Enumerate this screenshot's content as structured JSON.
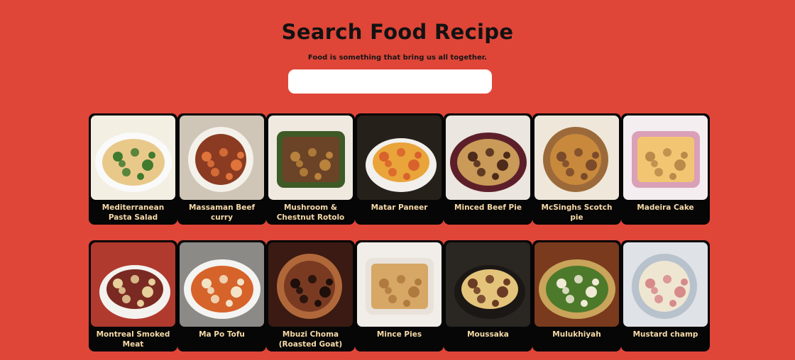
{
  "header": {
    "title": "Search Food Recipe",
    "subtitle": "Food is something that bring us all together."
  },
  "search": {
    "value": "",
    "placeholder": ""
  },
  "colors": {
    "background": "#df4638",
    "card": "#060606",
    "card_text": "#f6d9a8",
    "search_bg": "#ffffff"
  },
  "recipes": [
    {
      "name": "Mediterranean Pasta Salad",
      "image": "pasta-salad-photo",
      "palette": [
        "#f3efe3",
        "#e9c98a",
        "#3f7a2e",
        "#c9352b"
      ]
    },
    {
      "name": "Massaman Beef curry",
      "image": "beef-curry-photo",
      "palette": [
        "#cfc6b8",
        "#8a3b22",
        "#e0743a",
        "#f4f1ea"
      ]
    },
    {
      "name": "Mushroom & Chestnut Rotolo",
      "image": "rotolo-photo",
      "palette": [
        "#efe9e0",
        "#6b4326",
        "#b9823d",
        "#3e5a26"
      ]
    },
    {
      "name": "Matar Paneer",
      "image": "matar-paneer-photo",
      "palette": [
        "#26201a",
        "#e9a43a",
        "#d9622c",
        "#f2f0ec"
      ]
    },
    {
      "name": "Minced Beef Pie",
      "image": "beef-pie-photo",
      "palette": [
        "#ebe6df",
        "#c99a58",
        "#4d2a1a",
        "#5c1f2a"
      ]
    },
    {
      "name": "McSinghs Scotch pie",
      "image": "scotch-pie-photo",
      "palette": [
        "#efe8da",
        "#c8893c",
        "#7a4a2a",
        "#9c6a3a"
      ]
    },
    {
      "name": "Madeira Cake",
      "image": "madeira-cake-photo",
      "palette": [
        "#f4eef0",
        "#f2c572",
        "#b98a4a",
        "#d9a0b8"
      ]
    },
    {
      "name": "Montreal Smoked Meat",
      "image": "smoked-meat-photo",
      "palette": [
        "#b03a2e",
        "#7a2a22",
        "#e6cf9a",
        "#f4f2ee"
      ]
    },
    {
      "name": "Ma Po Tofu",
      "image": "ma-po-tofu-photo",
      "palette": [
        "#8c8a86",
        "#d6632a",
        "#f3e3c6",
        "#f4f4f2"
      ]
    },
    {
      "name": "Mbuzi Choma (Roasted Goat)",
      "image": "roasted-goat-photo",
      "palette": [
        "#3a1a12",
        "#7a3a22",
        "#1e0f0a",
        "#b0683a"
      ]
    },
    {
      "name": "Mince Pies",
      "image": "mince-pies-photo",
      "palette": [
        "#f1ede8",
        "#d7a766",
        "#b07a3e",
        "#e9e2da"
      ]
    },
    {
      "name": "Moussaka",
      "image": "moussaka-photo",
      "palette": [
        "#2a2622",
        "#e4c47a",
        "#6b3a24",
        "#1a1715"
      ]
    },
    {
      "name": "Mulukhiyah",
      "image": "mulukhiyah-photo",
      "palette": [
        "#7a3a1e",
        "#4c7a2a",
        "#f1ead6",
        "#c9a45a"
      ]
    },
    {
      "name": "Mustard champ",
      "image": "mustard-champ-photo",
      "palette": [
        "#dfe3e8",
        "#efe6d2",
        "#d78a8a",
        "#b8c2cc"
      ]
    }
  ]
}
